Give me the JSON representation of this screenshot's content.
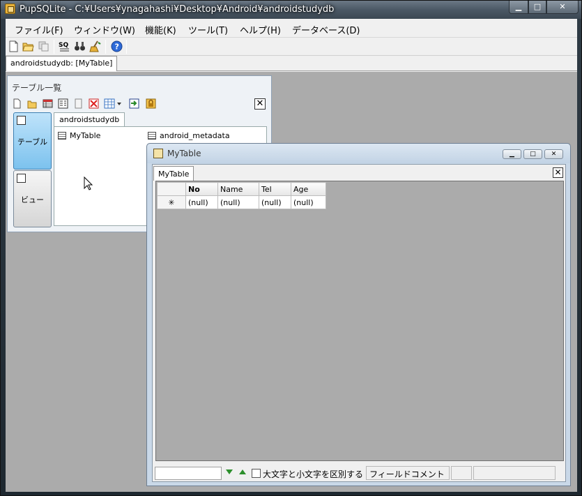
{
  "window": {
    "title": "PupSQLite - C:¥Users¥ynagahashi¥Desktop¥Android¥androidstudydb",
    "min_glyph": "▁",
    "max_glyph": "□",
    "close_glyph": "✕"
  },
  "menu": [
    "ファイル(F)",
    "ウィンドウ(W)",
    "機能(K)",
    "ツール(T)",
    "ヘルプ(H)",
    "データベース(D)"
  ],
  "toolbar": {
    "icons": [
      "new-file-icon",
      "open-folder-icon",
      "copy-icon",
      "sql-icon",
      "binoculars-icon",
      "broom-icon",
      "help-icon"
    ],
    "sql_label": "SQ"
  },
  "doc_tab": {
    "label": "androidstudydb: [MyTable]"
  },
  "table_list": {
    "title": "テーブル一覧",
    "close_glyph": "✕",
    "side_tables": "テーブル",
    "side_views": "ビュー",
    "db_tab": "androidstudydb",
    "tables": [
      "MyTable",
      "android_metadata"
    ]
  },
  "child_window": {
    "title": "MyTable",
    "tab": "MyTable",
    "close_glyph": "✕",
    "columns": [
      "No",
      "Name",
      "Tel",
      "Age"
    ],
    "new_row_marker": "✳",
    "new_row_values": [
      "(null)",
      "(null)",
      "(null)",
      "(null)"
    ]
  },
  "statusbar": {
    "search_value": "",
    "case_label": "大文字と小文字を区別する",
    "field_comment": "フィールドコメント"
  }
}
